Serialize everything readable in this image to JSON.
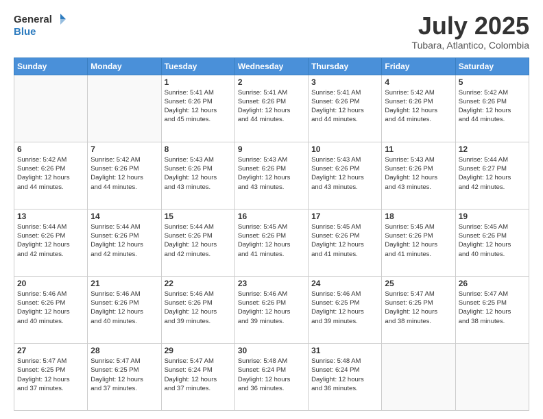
{
  "header": {
    "logo_line1": "General",
    "logo_line2": "Blue",
    "main_title": "July 2025",
    "subtitle": "Tubara, Atlantico, Colombia"
  },
  "days_of_week": [
    "Sunday",
    "Monday",
    "Tuesday",
    "Wednesday",
    "Thursday",
    "Friday",
    "Saturday"
  ],
  "weeks": [
    [
      {
        "day": "",
        "info": ""
      },
      {
        "day": "",
        "info": ""
      },
      {
        "day": "1",
        "info": "Sunrise: 5:41 AM\nSunset: 6:26 PM\nDaylight: 12 hours\nand 45 minutes."
      },
      {
        "day": "2",
        "info": "Sunrise: 5:41 AM\nSunset: 6:26 PM\nDaylight: 12 hours\nand 44 minutes."
      },
      {
        "day": "3",
        "info": "Sunrise: 5:41 AM\nSunset: 6:26 PM\nDaylight: 12 hours\nand 44 minutes."
      },
      {
        "day": "4",
        "info": "Sunrise: 5:42 AM\nSunset: 6:26 PM\nDaylight: 12 hours\nand 44 minutes."
      },
      {
        "day": "5",
        "info": "Sunrise: 5:42 AM\nSunset: 6:26 PM\nDaylight: 12 hours\nand 44 minutes."
      }
    ],
    [
      {
        "day": "6",
        "info": "Sunrise: 5:42 AM\nSunset: 6:26 PM\nDaylight: 12 hours\nand 44 minutes."
      },
      {
        "day": "7",
        "info": "Sunrise: 5:42 AM\nSunset: 6:26 PM\nDaylight: 12 hours\nand 44 minutes."
      },
      {
        "day": "8",
        "info": "Sunrise: 5:43 AM\nSunset: 6:26 PM\nDaylight: 12 hours\nand 43 minutes."
      },
      {
        "day": "9",
        "info": "Sunrise: 5:43 AM\nSunset: 6:26 PM\nDaylight: 12 hours\nand 43 minutes."
      },
      {
        "day": "10",
        "info": "Sunrise: 5:43 AM\nSunset: 6:26 PM\nDaylight: 12 hours\nand 43 minutes."
      },
      {
        "day": "11",
        "info": "Sunrise: 5:43 AM\nSunset: 6:26 PM\nDaylight: 12 hours\nand 43 minutes."
      },
      {
        "day": "12",
        "info": "Sunrise: 5:44 AM\nSunset: 6:27 PM\nDaylight: 12 hours\nand 42 minutes."
      }
    ],
    [
      {
        "day": "13",
        "info": "Sunrise: 5:44 AM\nSunset: 6:26 PM\nDaylight: 12 hours\nand 42 minutes."
      },
      {
        "day": "14",
        "info": "Sunrise: 5:44 AM\nSunset: 6:26 PM\nDaylight: 12 hours\nand 42 minutes."
      },
      {
        "day": "15",
        "info": "Sunrise: 5:44 AM\nSunset: 6:26 PM\nDaylight: 12 hours\nand 42 minutes."
      },
      {
        "day": "16",
        "info": "Sunrise: 5:45 AM\nSunset: 6:26 PM\nDaylight: 12 hours\nand 41 minutes."
      },
      {
        "day": "17",
        "info": "Sunrise: 5:45 AM\nSunset: 6:26 PM\nDaylight: 12 hours\nand 41 minutes."
      },
      {
        "day": "18",
        "info": "Sunrise: 5:45 AM\nSunset: 6:26 PM\nDaylight: 12 hours\nand 41 minutes."
      },
      {
        "day": "19",
        "info": "Sunrise: 5:45 AM\nSunset: 6:26 PM\nDaylight: 12 hours\nand 40 minutes."
      }
    ],
    [
      {
        "day": "20",
        "info": "Sunrise: 5:46 AM\nSunset: 6:26 PM\nDaylight: 12 hours\nand 40 minutes."
      },
      {
        "day": "21",
        "info": "Sunrise: 5:46 AM\nSunset: 6:26 PM\nDaylight: 12 hours\nand 40 minutes."
      },
      {
        "day": "22",
        "info": "Sunrise: 5:46 AM\nSunset: 6:26 PM\nDaylight: 12 hours\nand 39 minutes."
      },
      {
        "day": "23",
        "info": "Sunrise: 5:46 AM\nSunset: 6:26 PM\nDaylight: 12 hours\nand 39 minutes."
      },
      {
        "day": "24",
        "info": "Sunrise: 5:46 AM\nSunset: 6:25 PM\nDaylight: 12 hours\nand 39 minutes."
      },
      {
        "day": "25",
        "info": "Sunrise: 5:47 AM\nSunset: 6:25 PM\nDaylight: 12 hours\nand 38 minutes."
      },
      {
        "day": "26",
        "info": "Sunrise: 5:47 AM\nSunset: 6:25 PM\nDaylight: 12 hours\nand 38 minutes."
      }
    ],
    [
      {
        "day": "27",
        "info": "Sunrise: 5:47 AM\nSunset: 6:25 PM\nDaylight: 12 hours\nand 37 minutes."
      },
      {
        "day": "28",
        "info": "Sunrise: 5:47 AM\nSunset: 6:25 PM\nDaylight: 12 hours\nand 37 minutes."
      },
      {
        "day": "29",
        "info": "Sunrise: 5:47 AM\nSunset: 6:24 PM\nDaylight: 12 hours\nand 37 minutes."
      },
      {
        "day": "30",
        "info": "Sunrise: 5:48 AM\nSunset: 6:24 PM\nDaylight: 12 hours\nand 36 minutes."
      },
      {
        "day": "31",
        "info": "Sunrise: 5:48 AM\nSunset: 6:24 PM\nDaylight: 12 hours\nand 36 minutes."
      },
      {
        "day": "",
        "info": ""
      },
      {
        "day": "",
        "info": ""
      }
    ]
  ]
}
